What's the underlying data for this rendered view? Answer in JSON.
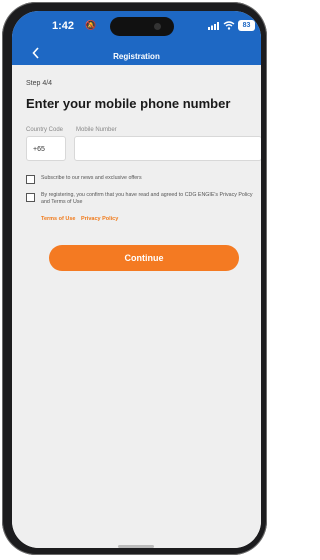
{
  "status_bar": {
    "time": "1:42",
    "battery": "83"
  },
  "header": {
    "title": "Registration"
  },
  "form": {
    "step": "Step 4/4",
    "heading": "Enter your mobile phone number",
    "country_code_label": "Country Code",
    "country_code_value": "+65",
    "mobile_label": "Mobile Number",
    "mobile_value": "",
    "subscribe_text": "Subscribe to our news and exclusive offers",
    "agreement_text": "By registering, you confirm that you have read and agreed to CDG ENGIE's Privacy Policy and Terms of Use",
    "terms_link": "Terms of Use",
    "privacy_link": "Privacy Policy",
    "continue_label": "Continue"
  },
  "colors": {
    "header": "#1e68c4",
    "accent": "#f47a22"
  }
}
